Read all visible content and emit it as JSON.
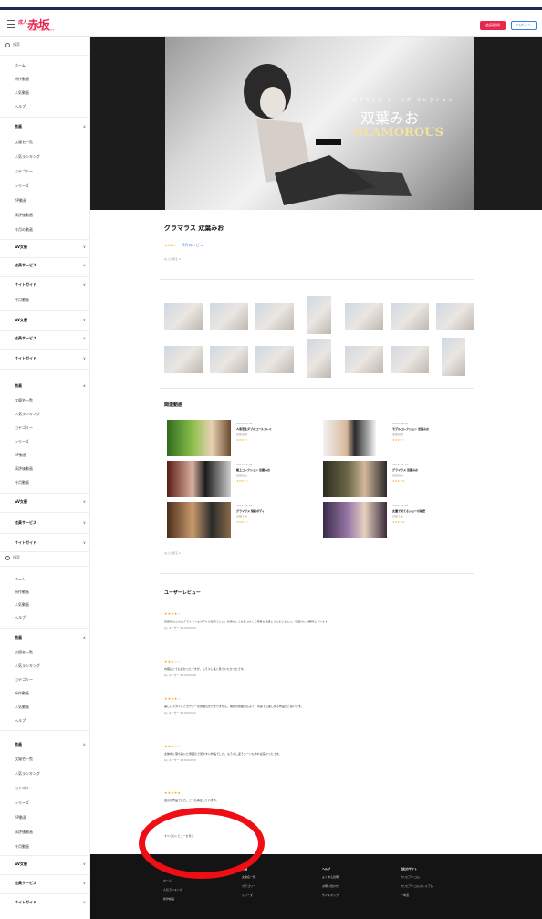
{
  "header": {
    "logo_small": "成人",
    "logo_main": "赤坂",
    "logo_tag": "ADULT VIDEO SITE",
    "register_label": "会員登録",
    "login_label": "ログイン"
  },
  "sidebar": {
    "search_placeholder": "検索",
    "top_links": [
      "ホーム",
      "新作動画",
      "人気動画",
      "ヘルプ"
    ],
    "video_section": {
      "heading": "動画",
      "items": [
        "女優名一覧",
        "人気ランキング",
        "カテゴリー",
        "シリーズ",
        "SP動画",
        "高評価動画",
        "今月の動画"
      ]
    },
    "group1": [
      "AV女優",
      "会員サービス",
      "サイトガイド",
      "今月動画",
      "AV女優",
      "会員サービス",
      "サイトガイド"
    ],
    "video_section_2": {
      "heading": "動画",
      "items": [
        "女優名一覧",
        "人気ランキング",
        "カテゴリー",
        "シリーズ",
        "SP動画",
        "高評価動画",
        "今月動画"
      ]
    },
    "group2": [
      "AV女優",
      "会員サービス",
      "サイトガイド"
    ],
    "search_placeholder_2": "検索",
    "top_links_2": [
      "ホーム",
      "新作動画",
      "人気動画",
      "ヘルプ"
    ],
    "video_section_3": {
      "heading": "動画",
      "items": [
        "女優名一覧",
        "人気ランキング",
        "カテゴリー",
        "新作動画",
        "人気動画",
        "ヘルプ"
      ]
    },
    "video_section_4": {
      "heading": "動画",
      "items": [
        "女優名一覧",
        "人気ランキング",
        "カテゴリー",
        "シリーズ",
        "SP動画",
        "高評価動画",
        "今月動画"
      ]
    },
    "group3": [
      "AV女優",
      "会員サービス",
      "サイトガイド"
    ]
  },
  "hero": {
    "subtitle": "グラマラス ガールズ コレクション",
    "name": "双葉みお",
    "brand": "GLAMOROUS"
  },
  "title": "グラマラス 双葉みお",
  "rating": {
    "stars": "★★★★☆",
    "link": "5件のレビュー"
  },
  "more_label": "もっと見る ∨",
  "related": {
    "heading": "関連動画",
    "items": [
      {
        "date": "2015-01-30",
        "name": "人妻淫乱ダブルコースプレイ",
        "actress": "双葉みお",
        "stars": "★★★★☆"
      },
      {
        "date": "2015-02-05",
        "name": "モデルコレクション 双葉みお",
        "actress": "双葉みお",
        "stars": "★★★★☆"
      },
      {
        "date": "2017-07-07",
        "name": "極上コレクション 双葉みお",
        "actress": "双葉みお",
        "stars": "★★★★☆"
      },
      {
        "date": "2016-04-10",
        "name": "グラマラス 双葉みお",
        "actress": "双葉みお",
        "stars": "★★★★★"
      },
      {
        "date": "2015-05-15",
        "name": "グラマラス 悩殺ボディ",
        "actress": "双葉みお",
        "stars": "★★★★☆"
      },
      {
        "date": "2016-03-25",
        "name": "女優で見てるショーの秘密",
        "actress": "双葉みお",
        "stars": "★★★★★"
      }
    ],
    "more": "もっと見る ∨"
  },
  "reviews": {
    "heading": "ユーザーレビュー",
    "items": [
      {
        "stars": "★★★★☆",
        "body": "双葉みおさんのグラマラスなボディが最高でした。表情もとても色っぽくて何度も見返してしまいました。次回作にも期待しています。",
        "meta": "by ユーザー 2015/02/03"
      },
      {
        "stars": "★★★☆☆",
        "body": "内容はとても良かったですが、もう少し長く見ていたかったです。",
        "meta": "by ユーザー 2015/02/08"
      },
      {
        "stars": "★★★★☆",
        "body": "美しいスタイルとセクシーな雰囲気がたまりません。撮影の雰囲気もよく、何度でも楽しめる作品だと思います。",
        "meta": "by ユーザー 2015/02/12"
      },
      {
        "stars": "★★★☆☆",
        "body": "全体的に落ち着いた雰囲気で見やすい作品でした。もう少し違うシーンもあれば良かったです。",
        "meta": "by ユーザー 2015/02/20"
      },
      {
        "stars": "★★★★★",
        "body": "最高の作品でした。とても満足しています。",
        "meta": ""
      }
    ],
    "all_link": "すべてのレビューを見る"
  },
  "footer": {
    "columns": [
      {
        "heading": "",
        "items": [
          "ホーム",
          "人気ランキング",
          "新作動画"
        ]
      },
      {
        "heading": "動画",
        "items": [
          "女優名一覧",
          "カテゴリー",
          "シリーズ"
        ]
      },
      {
        "heading": "ヘルプ",
        "items": [
          "よくある質問",
          "お問い合わせ",
          "サイトマップ"
        ]
      },
      {
        "heading": "当社のサイト",
        "items": [
          "カリビアンコム",
          "カリビアンコムプレミアム",
          "一本道"
        ]
      }
    ]
  },
  "colors": {
    "brand": "#e8274f",
    "link": "#3a7be0",
    "star": "#f5a623",
    "footer_bg": "#141414",
    "annotation": "#ef0e14"
  }
}
